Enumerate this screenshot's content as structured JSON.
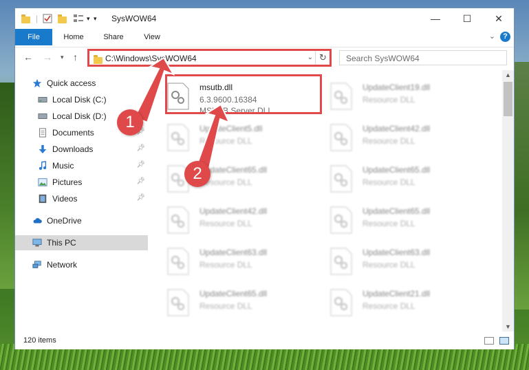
{
  "window": {
    "title": "SysWOW64"
  },
  "ribbon": {
    "tabs": [
      "File",
      "Home",
      "Share",
      "View"
    ]
  },
  "nav": {
    "address": "C:\\Windows\\SysWOW64",
    "search_placeholder": "Search SysWOW64"
  },
  "sidebar": {
    "items": [
      {
        "label": "Quick access",
        "icon": "star-icon",
        "pinned": false
      },
      {
        "label": "Local Disk (C:)",
        "icon": "drive-icon",
        "pinned": false
      },
      {
        "label": "Local Disk (D:)",
        "icon": "drive-icon",
        "pinned": false
      },
      {
        "label": "Documents",
        "icon": "documents-icon",
        "pinned": true
      },
      {
        "label": "Downloads",
        "icon": "download-icon",
        "pinned": true
      },
      {
        "label": "Music",
        "icon": "music-icon",
        "pinned": true
      },
      {
        "label": "Pictures",
        "icon": "pictures-icon",
        "pinned": true
      },
      {
        "label": "Videos",
        "icon": "videos-icon",
        "pinned": true
      },
      {
        "label": "OneDrive",
        "icon": "cloud-icon",
        "pinned": false
      },
      {
        "label": "This PC",
        "icon": "computer-icon",
        "pinned": false
      },
      {
        "label": "Network",
        "icon": "network-icon",
        "pinned": false
      }
    ]
  },
  "files": {
    "highlighted": {
      "name": "msutb.dll",
      "version": "6.3.9600.16384",
      "description": "MSUTB Server DLL"
    },
    "left_column": [
      {
        "name": "UpdateClient5.dll",
        "type": "Resource DLL"
      },
      {
        "name": "UpdateClient65.dll",
        "type": "Resource DLL"
      },
      {
        "name": "UpdateClient42.dll",
        "type": "Resource DLL"
      },
      {
        "name": "UpdateClient63.dll",
        "type": "Resource DLL"
      },
      {
        "name": "UpdateClient65.dll",
        "type": "Resource DLL"
      }
    ],
    "right_column": [
      {
        "name": "UpdateClient19.dll",
        "type": "Resource DLL"
      },
      {
        "name": "UpdateClient42.dll",
        "type": "Resource DLL"
      },
      {
        "name": "UpdateClient65.dll",
        "type": "Resource DLL"
      },
      {
        "name": "UpdateClient65.dll",
        "type": "Resource DLL"
      },
      {
        "name": "UpdateClient63.dll",
        "type": "Resource DLL"
      },
      {
        "name": "UpdateClient21.dll",
        "type": "Resource DLL"
      }
    ]
  },
  "status": {
    "item_count": "120 items"
  },
  "annotations": {
    "step1": "1",
    "step2": "2",
    "color": "#e0494a"
  }
}
